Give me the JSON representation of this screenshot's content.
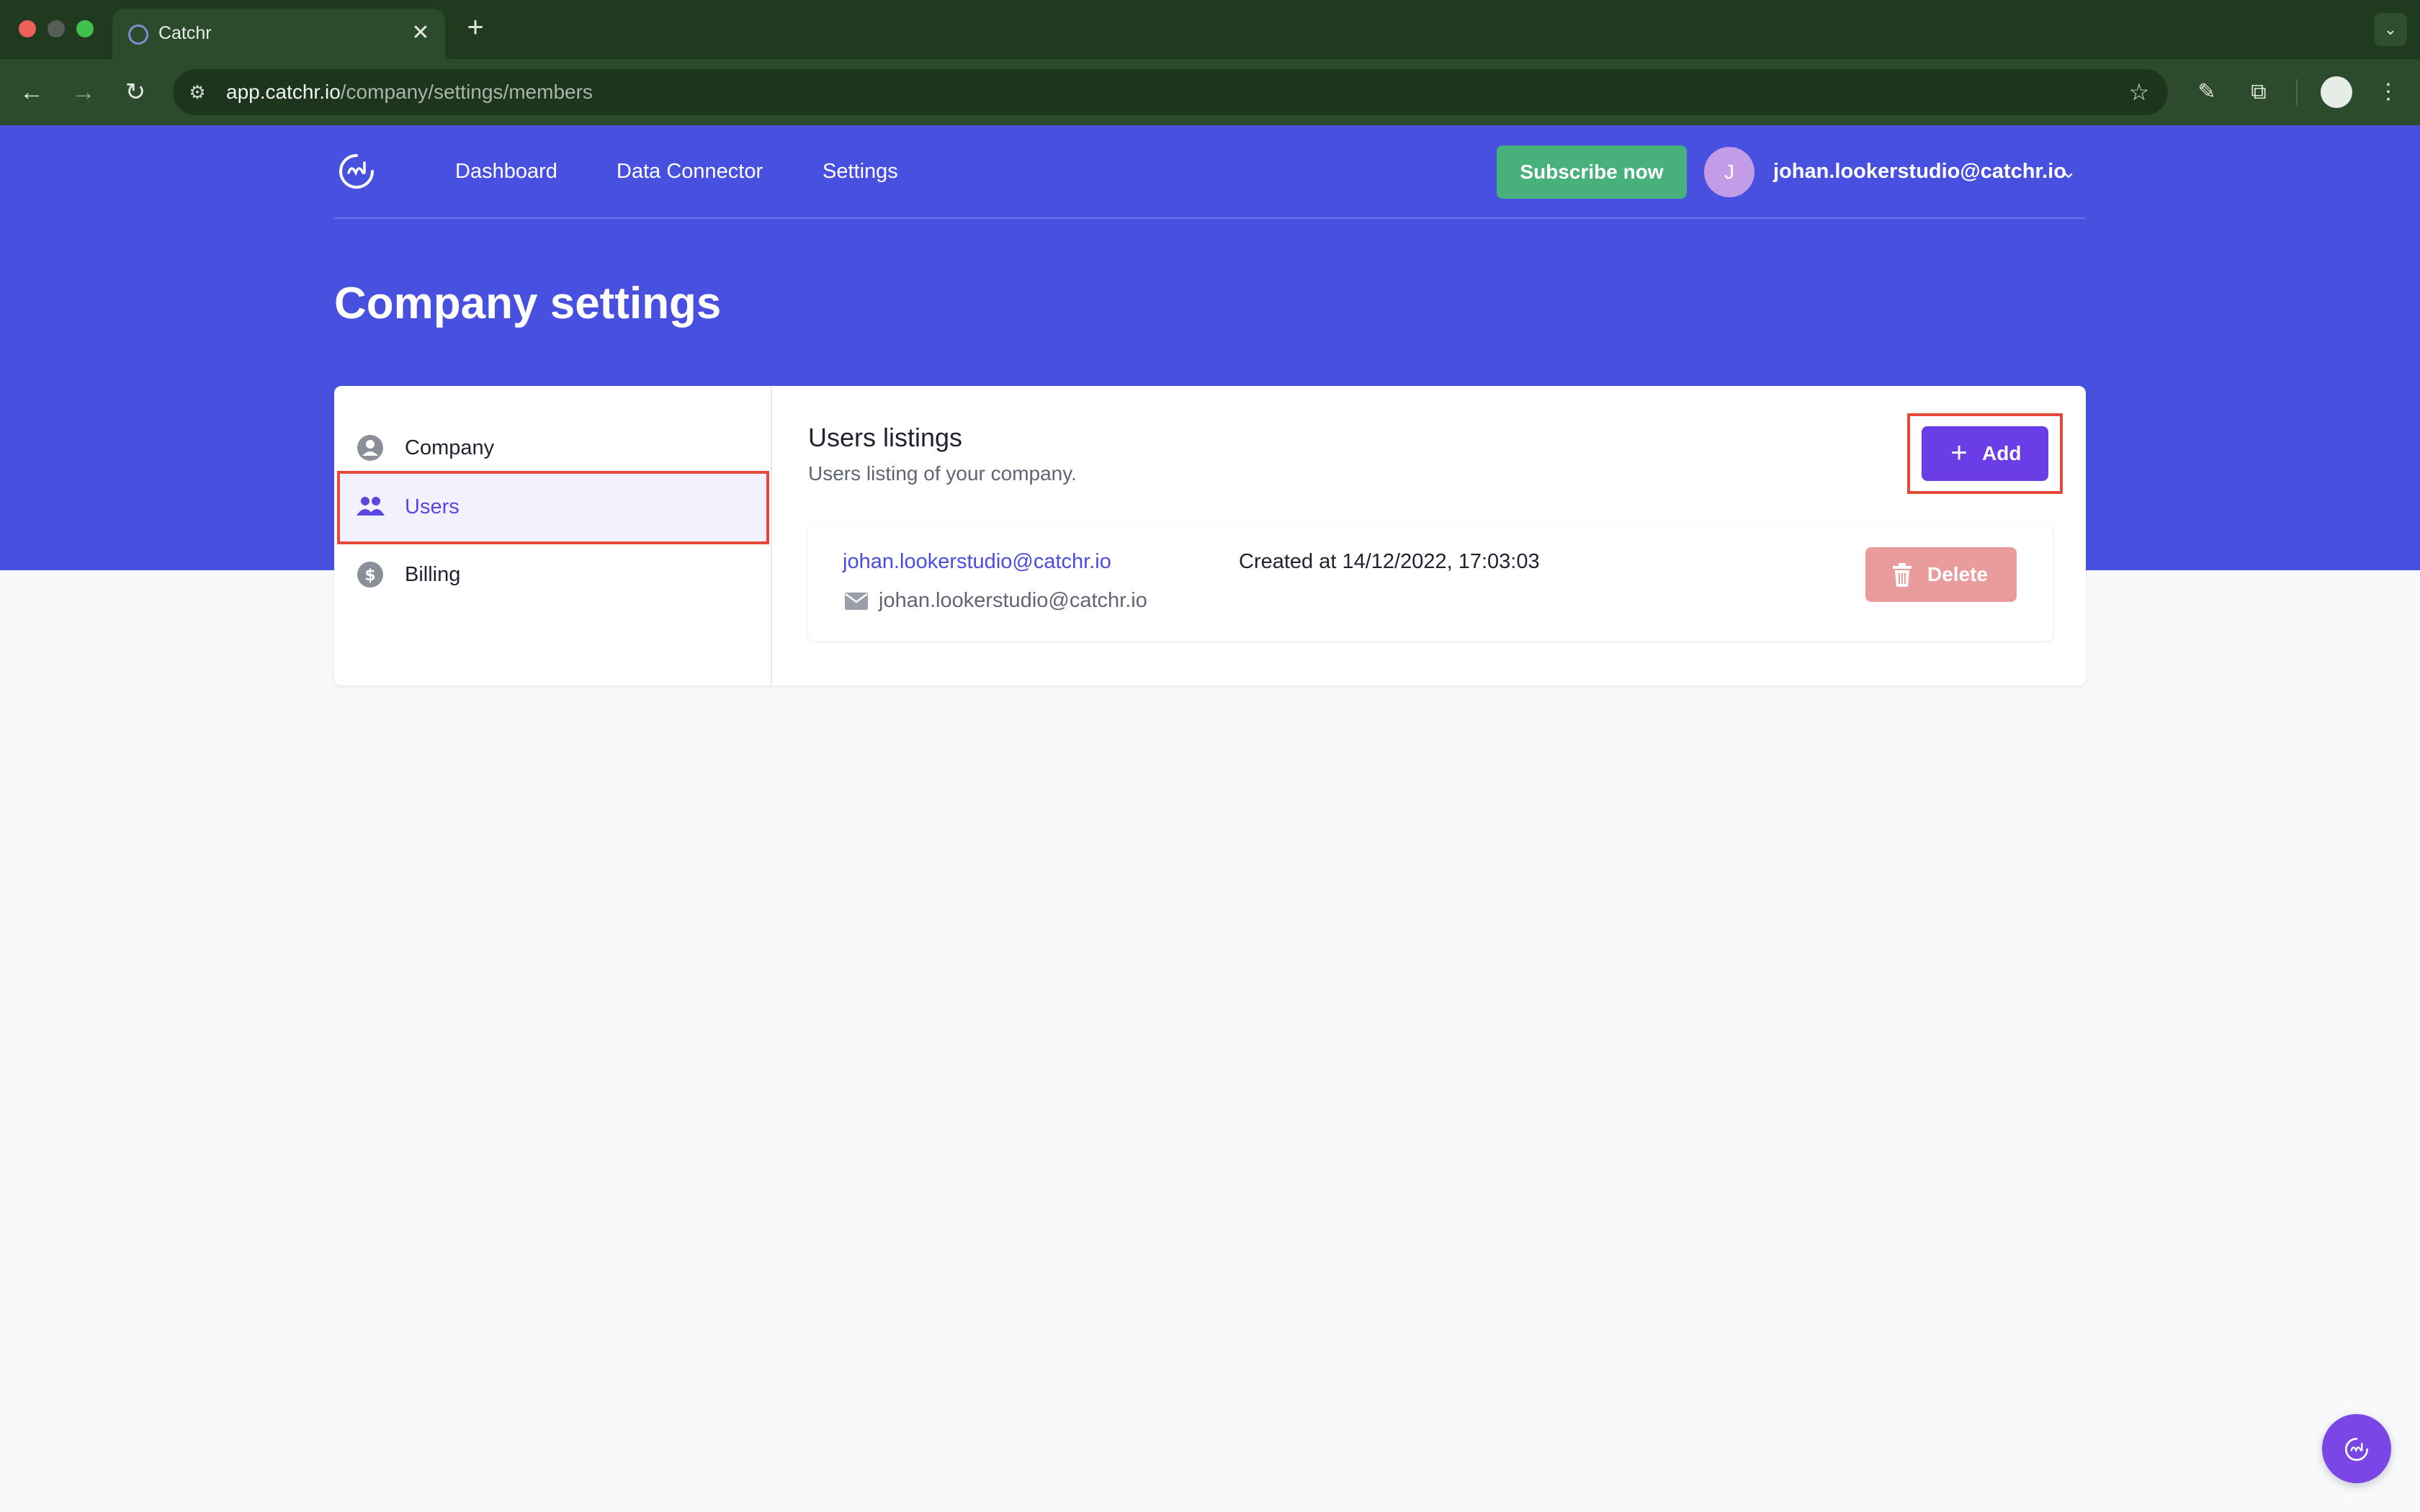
{
  "browser": {
    "tab_title": "Catchr",
    "tab_close": "✕",
    "new_tab": "+",
    "url_host": "app.catchr.io",
    "url_path": "/company/settings/members"
  },
  "app": {
    "nav": [
      "Dashboard",
      "Data Connector",
      "Settings"
    ],
    "subscribe_label": "Subscribe now",
    "avatar_initial": "J",
    "user_email": "johan.lookerstudio@catchr.io",
    "page_title": "Company settings"
  },
  "sidebar": {
    "items": [
      {
        "label": "Company",
        "icon": "user-circle-icon"
      },
      {
        "label": "Users",
        "icon": "users-icon",
        "active": true
      },
      {
        "label": "Billing",
        "icon": "dollar-circle-icon"
      }
    ]
  },
  "main": {
    "title": "Users listings",
    "subtitle": "Users listing of your company.",
    "add_label": "Add",
    "users": [
      {
        "name": "johan.lookerstudio@catchr.io",
        "email": "johan.lookerstudio@catchr.io",
        "created": "Created at 14/12/2022, 17:03:03",
        "delete_label": "Delete"
      }
    ]
  },
  "colors": {
    "brand": "#4850e0",
    "subscribe": "#48b07a",
    "add": "#6a3de6",
    "delete": "#ea9b9b",
    "highlight": "#e6493a"
  }
}
